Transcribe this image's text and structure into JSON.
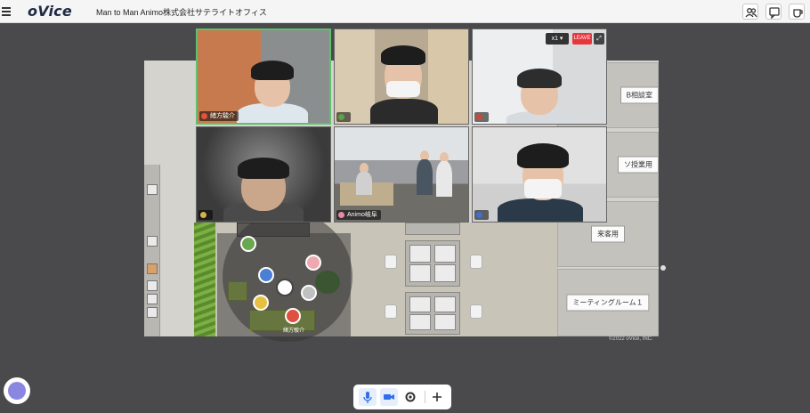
{
  "app": {
    "logo": "oVice",
    "space_title": "Man to Man Animo株式会社サテライトオフィス"
  },
  "header_icons": [
    "people-icon",
    "chat-icon",
    "coffee-icon"
  ],
  "video_tiles": [
    {
      "name": "緒方駿介",
      "dot_color": "#e2533f",
      "active": true
    },
    {
      "name": "",
      "dot_color": "#5aa347",
      "active": false
    },
    {
      "name": "",
      "dot_color": "#c94a32",
      "active": false
    },
    {
      "name": "",
      "dot_color": "#d6b14a",
      "active": false
    },
    {
      "name": "Animo岐阜",
      "dot_color": "#e58aa8",
      "active": false
    },
    {
      "name": "",
      "dot_color": "#3e6fd1",
      "active": false
    }
  ],
  "video_controls": {
    "zoom": "x1",
    "leave": "LEAVE"
  },
  "rooms": [
    {
      "label": "B相談室"
    },
    {
      "label": "ソ授業用"
    },
    {
      "label": "来客用"
    },
    {
      "label": "ミーティングルーム１"
    }
  ],
  "map_avatars": [
    {
      "name": "",
      "color": "#6aa84f"
    },
    {
      "name": "",
      "color": "#4a7fd6"
    },
    {
      "name": "",
      "color": "#f0a8b0"
    },
    {
      "name": "",
      "color": "#c0c0c0"
    },
    {
      "name": "",
      "color": "#e6c040"
    },
    {
      "name": "緒方駿介",
      "color": "#e05040"
    }
  ],
  "copyright": "©2022 oVice, INC.",
  "bottom_bar": [
    "microphone-icon",
    "camera-icon",
    "settings-icon",
    "add-icon"
  ],
  "colors": {
    "accent": "#2f6fe8",
    "leave": "#e8363f",
    "active_border": "#5ec16b"
  }
}
